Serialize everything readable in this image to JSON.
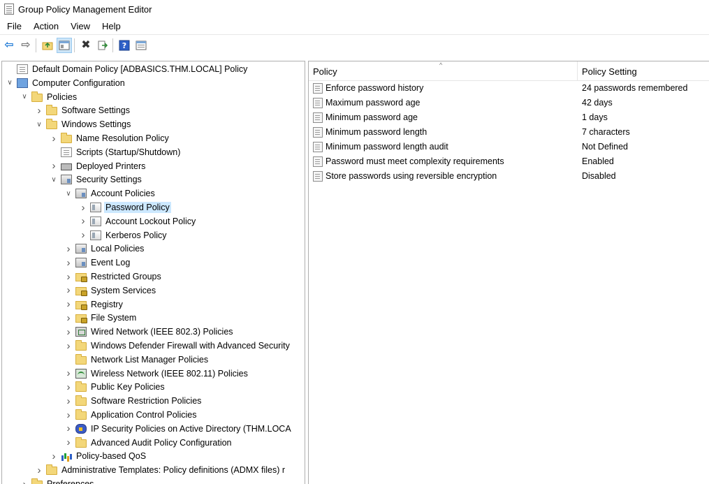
{
  "window": {
    "title": "Group Policy Management Editor"
  },
  "menu": [
    "File",
    "Action",
    "View",
    "Help"
  ],
  "toolbar": {
    "buttons": [
      "back-icon",
      "forward-icon",
      "up-folder-icon",
      "show-hide-tree-icon",
      "delete-icon",
      "export-list-icon",
      "help-icon",
      "properties-view-icon"
    ]
  },
  "tree": {
    "items": [
      {
        "label": "Default Domain Policy [ADBASICS.THM.LOCAL] Policy",
        "depth": 0,
        "expander": "none",
        "icon": "policy-doc-icon"
      },
      {
        "label": "Computer Configuration",
        "depth": 0,
        "expander": "expanded",
        "icon": "computer-icon"
      },
      {
        "label": "Policies",
        "depth": 1,
        "expander": "expanded",
        "icon": "folder-icon"
      },
      {
        "label": "Software Settings",
        "depth": 2,
        "expander": "collapsed",
        "icon": "folder-icon"
      },
      {
        "label": "Windows Settings",
        "depth": 2,
        "expander": "expanded",
        "icon": "folder-icon"
      },
      {
        "label": "Name Resolution Policy",
        "depth": 3,
        "expander": "collapsed",
        "icon": "folder-icon"
      },
      {
        "label": "Scripts (Startup/Shutdown)",
        "depth": 3,
        "expander": "none",
        "icon": "script-icon"
      },
      {
        "label": "Deployed Printers",
        "depth": 3,
        "expander": "collapsed",
        "icon": "printer-icon"
      },
      {
        "label": "Security Settings",
        "depth": 3,
        "expander": "expanded",
        "icon": "security-settings-icon"
      },
      {
        "label": "Account Policies",
        "depth": 4,
        "expander": "expanded",
        "icon": "security-settings-icon"
      },
      {
        "label": "Password Policy",
        "depth": 5,
        "expander": "collapsed",
        "icon": "policy-icon",
        "selected": true
      },
      {
        "label": "Account Lockout Policy",
        "depth": 5,
        "expander": "collapsed",
        "icon": "policy-icon"
      },
      {
        "label": "Kerberos Policy",
        "depth": 5,
        "expander": "collapsed",
        "icon": "policy-icon"
      },
      {
        "label": "Local Policies",
        "depth": 4,
        "expander": "collapsed",
        "icon": "security-settings-icon"
      },
      {
        "label": "Event Log",
        "depth": 4,
        "expander": "collapsed",
        "icon": "security-settings-icon"
      },
      {
        "label": "Restricted Groups",
        "depth": 4,
        "expander": "collapsed",
        "icon": "lock-folder-icon"
      },
      {
        "label": "System Services",
        "depth": 4,
        "expander": "collapsed",
        "icon": "lock-folder-icon"
      },
      {
        "label": "Registry",
        "depth": 4,
        "expander": "collapsed",
        "icon": "lock-folder-icon"
      },
      {
        "label": "File System",
        "depth": 4,
        "expander": "collapsed",
        "icon": "lock-folder-icon"
      },
      {
        "label": "Wired Network (IEEE 802.3) Policies",
        "depth": 4,
        "expander": "collapsed",
        "icon": "wired-network-icon"
      },
      {
        "label": "Windows Defender Firewall with Advanced Security",
        "depth": 4,
        "expander": "collapsed",
        "icon": "folder-icon"
      },
      {
        "label": "Network List Manager Policies",
        "depth": 4,
        "expander": "none",
        "icon": "folder-icon"
      },
      {
        "label": "Wireless Network (IEEE 802.11) Policies",
        "depth": 4,
        "expander": "collapsed",
        "icon": "wireless-network-icon"
      },
      {
        "label": "Public Key Policies",
        "depth": 4,
        "expander": "collapsed",
        "icon": "folder-icon"
      },
      {
        "label": "Software Restriction Policies",
        "depth": 4,
        "expander": "collapsed",
        "icon": "folder-icon"
      },
      {
        "label": "Application Control Policies",
        "depth": 4,
        "expander": "collapsed",
        "icon": "folder-icon"
      },
      {
        "label": "IP Security Policies on Active Directory (THM.LOCA",
        "depth": 4,
        "expander": "collapsed",
        "icon": "ip-security-icon"
      },
      {
        "label": "Advanced Audit Policy Configuration",
        "depth": 4,
        "expander": "collapsed",
        "icon": "folder-icon"
      },
      {
        "label": "Policy-based QoS",
        "depth": 3,
        "expander": "collapsed",
        "icon": "qos-chart-icon"
      },
      {
        "label": "Administrative Templates: Policy definitions (ADMX files) r",
        "depth": 2,
        "expander": "collapsed",
        "icon": "folder-icon"
      },
      {
        "label": "Preferences",
        "depth": 1,
        "expander": "collapsed",
        "icon": "folder-icon"
      }
    ]
  },
  "list": {
    "columns": {
      "policy": "Policy",
      "setting": "Policy Setting"
    },
    "sort_indicator": "^",
    "rows": [
      {
        "policy": "Enforce password history",
        "setting": "24 passwords remembered"
      },
      {
        "policy": "Maximum password age",
        "setting": "42 days"
      },
      {
        "policy": "Minimum password age",
        "setting": "1 days"
      },
      {
        "policy": "Minimum password length",
        "setting": "7 characters"
      },
      {
        "policy": "Minimum password length audit",
        "setting": "Not Defined"
      },
      {
        "policy": "Password must meet complexity requirements",
        "setting": "Enabled"
      },
      {
        "policy": "Store passwords using reversible encryption",
        "setting": "Disabled"
      }
    ]
  },
  "colors": {
    "selection": "#cce8ff",
    "toolbar_active": "#cce4f7",
    "pane_border": "#aeaeae"
  }
}
